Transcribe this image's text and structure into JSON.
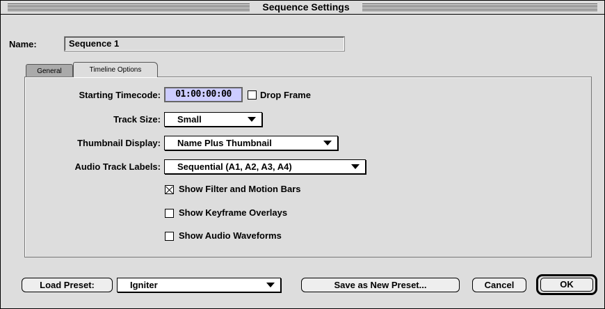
{
  "window": {
    "title": "Sequence Settings"
  },
  "name_row": {
    "label": "Name:",
    "value": "Sequence 1"
  },
  "tabs": [
    {
      "label": "General",
      "active": false
    },
    {
      "label": "Timeline Options",
      "active": true
    }
  ],
  "timeline": {
    "starting_timecode_label": "Starting Timecode:",
    "starting_timecode_value": "01:00:00:00",
    "drop_frame_label": "Drop Frame",
    "drop_frame_checked": false,
    "track_size_label": "Track Size:",
    "track_size_value": "Small",
    "thumbnail_display_label": "Thumbnail Display:",
    "thumbnail_display_value": "Name Plus Thumbnail",
    "audio_track_labels_label": "Audio Track Labels:",
    "audio_track_labels_value": "Sequential (A1, A2, A3, A4)",
    "checkboxes": [
      {
        "label": "Show Filter and Motion Bars",
        "checked": true
      },
      {
        "label": "Show Keyframe Overlays",
        "checked": false
      },
      {
        "label": "Show Audio Waveforms",
        "checked": false
      }
    ]
  },
  "footer": {
    "load_preset_label": "Load Preset:",
    "preset_value": "Igniter",
    "save_preset_label": "Save as New Preset...",
    "cancel_label": "Cancel",
    "ok_label": "OK"
  },
  "colors": {
    "timecode_highlight": "#ccccff",
    "window_bg": "#dddddd"
  }
}
